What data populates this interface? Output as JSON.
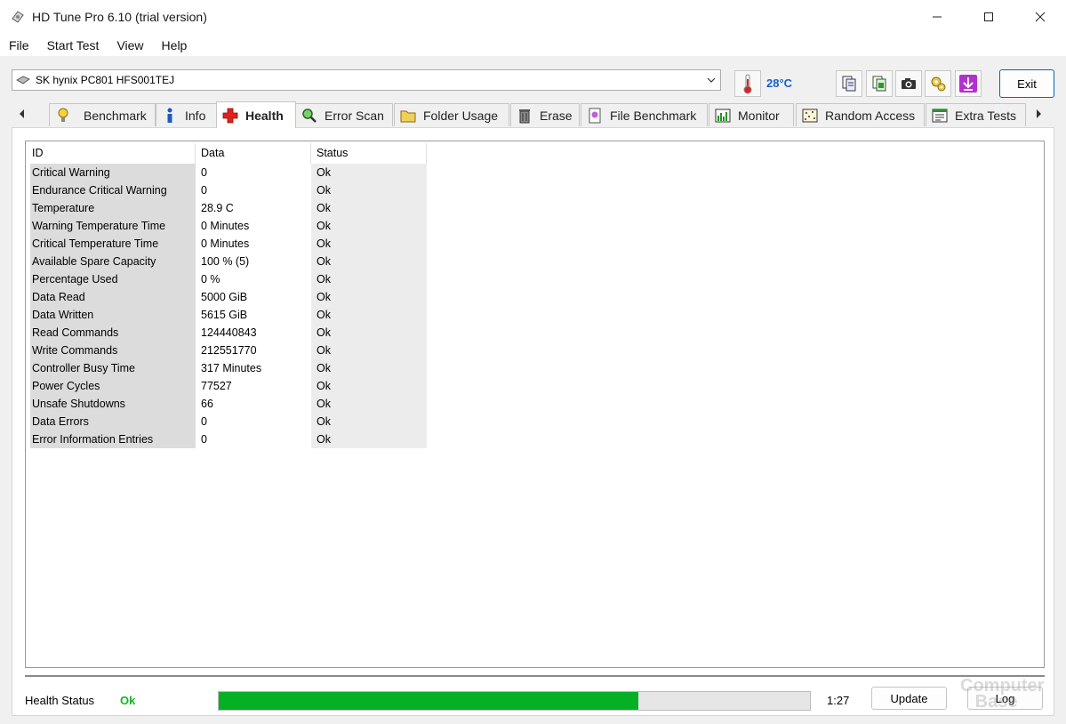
{
  "window": {
    "title": "HD Tune Pro 6.10 (trial version)"
  },
  "menu": [
    "File",
    "Start Test",
    "View",
    "Help"
  ],
  "drive": {
    "selected": "SK hynix PC801 HFS001TEJ",
    "temperature": "28°C"
  },
  "toolbar": {
    "exit_label": "Exit"
  },
  "tabs": [
    {
      "label": "Benchmark",
      "icon": "benchmark-icon"
    },
    {
      "label": "Info",
      "icon": "info-icon"
    },
    {
      "label": "Health",
      "icon": "health-icon",
      "active": true
    },
    {
      "label": "Error Scan",
      "icon": "error-scan-icon"
    },
    {
      "label": "Folder Usage",
      "icon": "folder-icon"
    },
    {
      "label": "Erase",
      "icon": "erase-icon"
    },
    {
      "label": "File Benchmark",
      "icon": "file-benchmark-icon"
    },
    {
      "label": "Monitor",
      "icon": "monitor-icon"
    },
    {
      "label": "Random Access",
      "icon": "random-access-icon"
    },
    {
      "label": "Extra Tests",
      "icon": "extra-tests-icon"
    }
  ],
  "health_table": {
    "columns": [
      "ID",
      "Data",
      "Status"
    ],
    "rows": [
      [
        "Critical Warning",
        "0",
        "Ok"
      ],
      [
        "Endurance Critical Warning",
        "0",
        "Ok"
      ],
      [
        "Temperature",
        "28.9 C",
        "Ok"
      ],
      [
        "Warning Temperature Time",
        "0 Minutes",
        "Ok"
      ],
      [
        "Critical Temperature Time",
        "0 Minutes",
        "Ok"
      ],
      [
        "Available Spare Capacity",
        "100 % (5)",
        "Ok"
      ],
      [
        "Percentage Used",
        "0 %",
        "Ok"
      ],
      [
        "Data Read",
        "5000 GiB",
        "Ok"
      ],
      [
        "Data Written",
        "5615 GiB",
        "Ok"
      ],
      [
        "Read Commands",
        "124440843",
        "Ok"
      ],
      [
        "Write Commands",
        "212551770",
        "Ok"
      ],
      [
        "Controller Busy Time",
        "317 Minutes",
        "Ok"
      ],
      [
        "Power Cycles",
        "77527",
        "Ok"
      ],
      [
        "Unsafe Shutdowns",
        "66",
        "Ok"
      ],
      [
        "Data Errors",
        "0",
        "Ok"
      ],
      [
        "Error Information Entries",
        "0",
        "Ok"
      ]
    ]
  },
  "status_bar": {
    "health_label": "Health Status",
    "health_value": "Ok",
    "progress_fraction": 0.71,
    "time": "1:27",
    "update_label": "Update",
    "log_label": "Log"
  },
  "colors": {
    "accent": "#0067c0",
    "ok_green": "#12b61f",
    "progress_green": "#06b025",
    "temp_blue": "#1860c8"
  },
  "watermark": "ComputerBase"
}
